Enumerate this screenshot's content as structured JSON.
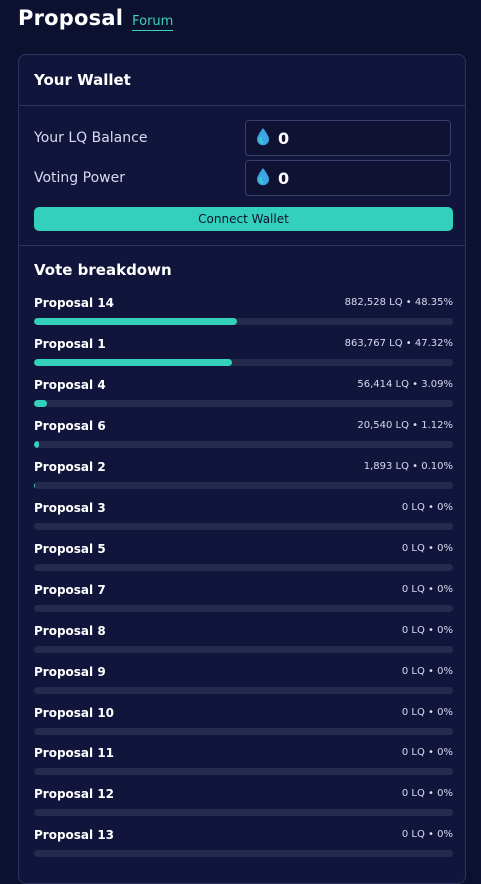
{
  "header": {
    "title": "Proposal",
    "forum_link": "Forum"
  },
  "wallet": {
    "title": "Your Wallet",
    "balance_label": "Your LQ Balance",
    "balance_value": "0",
    "power_label": "Voting Power",
    "power_value": "0",
    "connect_label": "Connect Wallet",
    "token_icon": "water-drop-icon"
  },
  "colors": {
    "accent": "#33d1bb",
    "track": "#262a4c",
    "background": "#0d1130",
    "card": "#12153b"
  },
  "vote_breakdown": {
    "title": "Vote breakdown",
    "proposals": [
      {
        "name": "Proposal 14",
        "stat": "882,528 LQ • 48.35%",
        "percent": 48.35
      },
      {
        "name": "Proposal 1",
        "stat": "863,767 LQ • 47.32%",
        "percent": 47.32
      },
      {
        "name": "Proposal 4",
        "stat": "56,414 LQ • 3.09%",
        "percent": 3.09
      },
      {
        "name": "Proposal 6",
        "stat": "20,540 LQ • 1.12%",
        "percent": 1.12
      },
      {
        "name": "Proposal 2",
        "stat": "1,893 LQ • 0.10%",
        "percent": 0.1
      },
      {
        "name": "Proposal 3",
        "stat": "0 LQ • 0%",
        "percent": 0
      },
      {
        "name": "Proposal 5",
        "stat": "0 LQ • 0%",
        "percent": 0
      },
      {
        "name": "Proposal 7",
        "stat": "0 LQ • 0%",
        "percent": 0
      },
      {
        "name": "Proposal 8",
        "stat": "0 LQ • 0%",
        "percent": 0
      },
      {
        "name": "Proposal 9",
        "stat": "0 LQ • 0%",
        "percent": 0
      },
      {
        "name": "Proposal 10",
        "stat": "0 LQ • 0%",
        "percent": 0
      },
      {
        "name": "Proposal 11",
        "stat": "0 LQ • 0%",
        "percent": 0
      },
      {
        "name": "Proposal 12",
        "stat": "0 LQ • 0%",
        "percent": 0
      },
      {
        "name": "Proposal 13",
        "stat": "0 LQ • 0%",
        "percent": 0
      }
    ]
  }
}
